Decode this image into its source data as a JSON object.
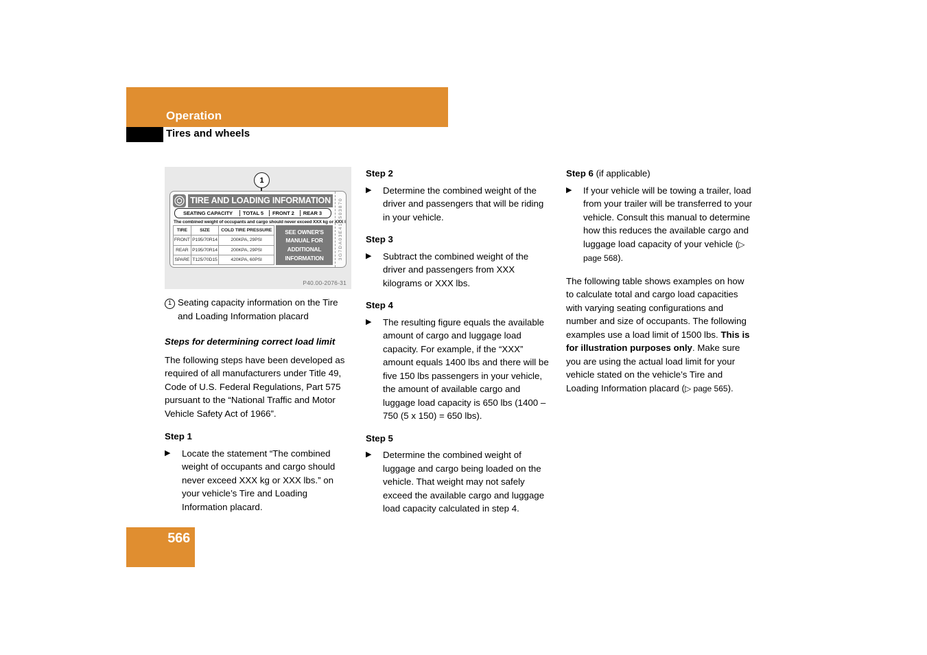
{
  "colors": {
    "accent_orange": "#e08e30",
    "black_tab": "#000000",
    "figure_bg": "#e9e9e9",
    "placard_gray": "#7a7a7a"
  },
  "header": {
    "section_title": "Operation",
    "page_title": "Tires and wheels"
  },
  "footer": {
    "page_number": "566"
  },
  "figure": {
    "code": "P40.00-2076-31",
    "callout_number": "1",
    "placard": {
      "title": "TIRE AND LOADING INFORMATION",
      "seating_label": "SEATING CAPACITY",
      "seating_total": "TOTAL 5",
      "seating_front": "FRONT 2",
      "seating_rear": "REAR 3",
      "note": "The combined weight of occupants and cargo should never exceed XXX kg or XXX lbs.*",
      "table": {
        "headers": [
          "TIRE",
          "SIZE",
          "COLD TIRE PRESSURE"
        ],
        "rows": [
          [
            "FRONT",
            "P195/70R14",
            "200KPA, 29PSI"
          ],
          [
            "REAR",
            "P195/70R14",
            "200KPA, 29PSI"
          ],
          [
            "SPARE",
            "T125/70D15",
            "420KPA, 60PSI"
          ]
        ]
      },
      "owners_box": [
        "SEE OWNER'S",
        "MANUAL FOR",
        "ADDITIONAL",
        "INFORMATION"
      ],
      "serial": "3G7DA03E41S503870"
    },
    "caption_number": "1",
    "caption_text": "Seating capacity information on the Tire and Loading Information placard"
  },
  "column_1": {
    "subhead": "Steps for determining correct load limit",
    "intro_paragraph": "The following steps have been developed as required of all manufacturers under Title 49, Code of U.S. Federal Regulations, Part 575 pursuant to the “National Traffic and Motor Vehicle Safety Act of 1966”.",
    "step_1": {
      "heading": "Step 1",
      "bullet_marker": "▶",
      "text": "Locate the statement “The combined weight of occupants and cargo should never exceed XXX kg or XXX lbs.” on your vehicle’s Tire and Loading Information placard."
    }
  },
  "column_2": {
    "step_2": {
      "heading": "Step 2",
      "bullet_marker": "▶",
      "text": "Determine the combined weight of the driver and passengers that will be riding in your vehicle."
    },
    "step_3": {
      "heading": "Step 3",
      "bullet_marker": "▶",
      "text": "Subtract the combined weight of the driver and passengers from XXX kilograms or XXX lbs."
    },
    "step_4": {
      "heading": "Step 4",
      "bullet_marker": "▶",
      "text": "The resulting figure equals the available amount of cargo and luggage load capacity. For example, if the “XXX” amount equals 1400 lbs and there will be five 150 lbs passengers in your vehicle, the amount of available cargo and luggage load capacity is 650 lbs (1400 – 750 (5 x 150) = 650 lbs)."
    },
    "step_5": {
      "heading": "Step 5",
      "bullet_marker": "▶",
      "text": "Determine the combined weight of luggage and cargo being loaded on the vehicle. That weight may not safely exceed the available cargo and luggage load capacity calculated in step 4."
    }
  },
  "column_3": {
    "step_6": {
      "heading": "Step 6",
      "heading_suffix": " (if applicable)",
      "bullet_marker": "▶",
      "text_before_ref": "If your vehicle will be towing a trailer, load from your trailer will be transferred to your vehicle. Consult this manual to determine how this reduces the available cargo and luggage load capacity of your vehicle (",
      "page_ref": "▷ page 568",
      "text_after_ref": ")."
    },
    "closing_paragraph": {
      "part_1": "The following table shows examples on how to calculate total and cargo load capacities with varying seating configurations and number and size of occupants. The following examples use a load limit of 1500 lbs. ",
      "bold_1": "This is for illustration purposes only",
      "part_2": ". Make sure you are using the actual load limit for your vehicle stated on the vehicle’s Tire and Loading Information placard (",
      "page_ref": "▷ page 565",
      "part_3": ")."
    }
  }
}
